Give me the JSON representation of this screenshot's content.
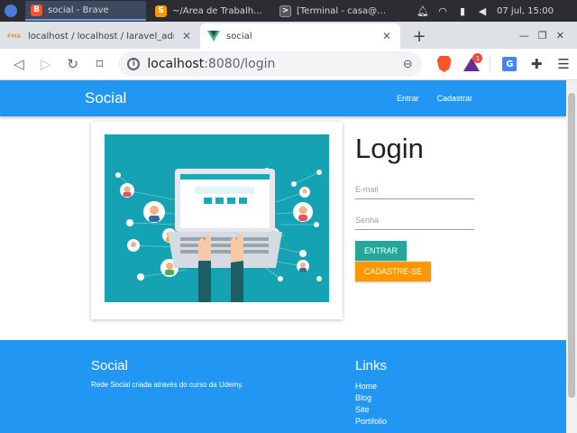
{
  "taskbar": {
    "tasks": [
      {
        "label": "social - Brave"
      },
      {
        "label": "~/Área de Trabalho/F..."
      },
      {
        "label": "[Terminal - casa@cas..."
      }
    ],
    "clock": "07 jul, 15:00"
  },
  "browser": {
    "tabs": [
      {
        "label": "localhost / localhost / laravel_admin_panel"
      },
      {
        "label": "social"
      }
    ],
    "url_host": "localhost",
    "url_rest": ":8080/login",
    "rewards_badge": "1"
  },
  "site": {
    "brand": "Social",
    "nav": [
      {
        "label": "Entrar"
      },
      {
        "label": "Cadastrar"
      }
    ]
  },
  "login": {
    "title": "Login",
    "email_placeholder": "E-mail",
    "password_placeholder": "Senha",
    "submit_label": "ENTRAR",
    "register_label": "CADASTRE-SE"
  },
  "footer": {
    "title": "Social",
    "description": "Rede Social criada através do curso da Udemy.",
    "links_title": "Links",
    "links": [
      {
        "label": "Home"
      },
      {
        "label": "Blog"
      },
      {
        "label": "Site"
      },
      {
        "label": "Portifolio"
      }
    ]
  },
  "colors": {
    "primary": "#2196f3",
    "success": "#26a69a",
    "warning": "#ff9800",
    "hero_bg": "#15a3b4"
  }
}
